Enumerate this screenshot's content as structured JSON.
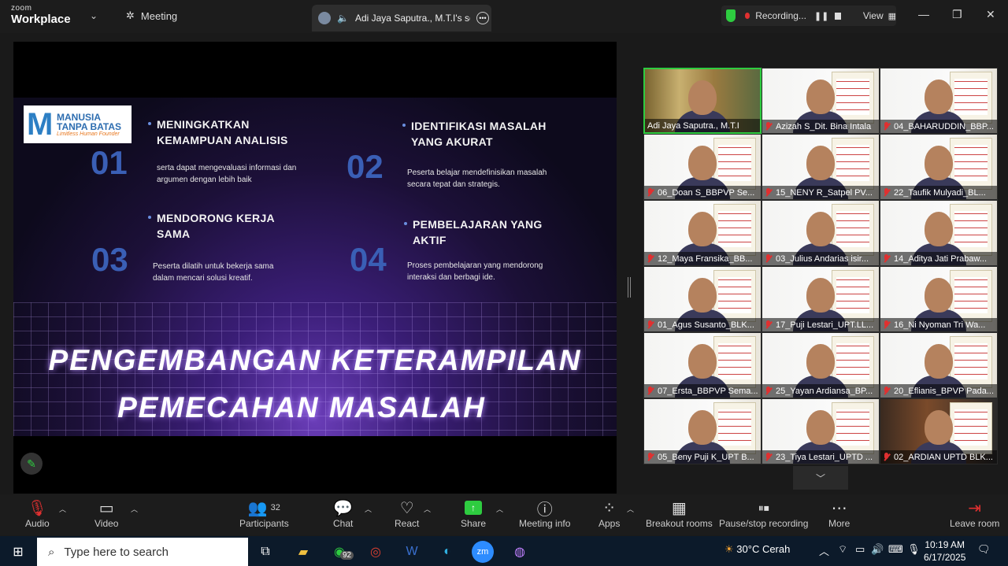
{
  "titlebar": {
    "brand_top": "zoom",
    "brand_bottom": "Workplace",
    "meeting_label": "Meeting",
    "share_tab_label": "Adi Jaya Saputra., M.T.I's scre",
    "recording_label": "Recording...",
    "view_label": "View"
  },
  "slide": {
    "logo_line1": "MANUSIA",
    "logo_line2": "TANPA BATAS",
    "logo_tagline": "Limitless Human Founder",
    "items": [
      {
        "num": "01",
        "head1": "MENINGKATKAN",
        "head2": "KEMAMPUAN ANALISIS",
        "desc1": "serta dapat mengevaluasi informasi dan",
        "desc2": "argumen dengan lebih baik"
      },
      {
        "num": "02",
        "head1": "IDENTIFIKASI MASALAH",
        "head2": "YANG AKURAT",
        "desc1": "Peserta belajar mendefinisikan masalah",
        "desc2": "secara tepat dan strategis."
      },
      {
        "num": "03",
        "head1": "MENDORONG KERJA",
        "head2": "SAMA",
        "desc1": "Peserta dilatih untuk bekerja sama",
        "desc2": "dalam mencari solusi kreatif."
      },
      {
        "num": "04",
        "head1": "PEMBELAJARAN YANG",
        "head2": "AKTIF",
        "desc1": "Proses pembelajaran yang mendorong",
        "desc2": "interaksi dan berbagi ide."
      }
    ],
    "title1": "PENGEMBANGAN  KETERAMPILAN",
    "title2": "PEMECAHAN  MASALAH"
  },
  "participants": [
    "Adi Jaya Saputra., M.T.I",
    "Azizah S_Dit. Bina Intala",
    "04_BAHARUDDIN_BBP...",
    "06_Doan S_BBPVP Se...",
    "15_NENY R_Satpel PV...",
    "22_Taufik Mulyadi_BL...",
    "12_Maya Fransika_BB...",
    "03_Julius Andarias isir...",
    "14_Aditya Jati Prabaw...",
    "01_Agus Susanto_BLK...",
    "17_Puji Lestari_UPT.LL...",
    "16_Ni Nyoman Tri Wa...",
    "07_Ersta_BBPVP Sema...",
    "25_Yayan Ardiansa_BP...",
    "20_Eflianis_BPVP Pada...",
    "05_Beny Puji K_UPT B...",
    "23_Tiya Lestari_UPTD ...",
    "02_ARDIAN UPTD BLK..."
  ],
  "toolbar": {
    "audio": "Audio",
    "video": "Video",
    "participants": "Participants",
    "participants_count": "32",
    "chat": "Chat",
    "react": "React",
    "share": "Share",
    "meeting_info": "Meeting info",
    "apps": "Apps",
    "breakout": "Breakout rooms",
    "pause_rec": "Pause/stop recording",
    "more": "More",
    "leave": "Leave room"
  },
  "taskbar": {
    "search_placeholder": "Type here to search",
    "whatsapp_badge": "92",
    "weather": "30°C  Cerah",
    "time": "10:19 AM",
    "date": "6/17/2025"
  }
}
